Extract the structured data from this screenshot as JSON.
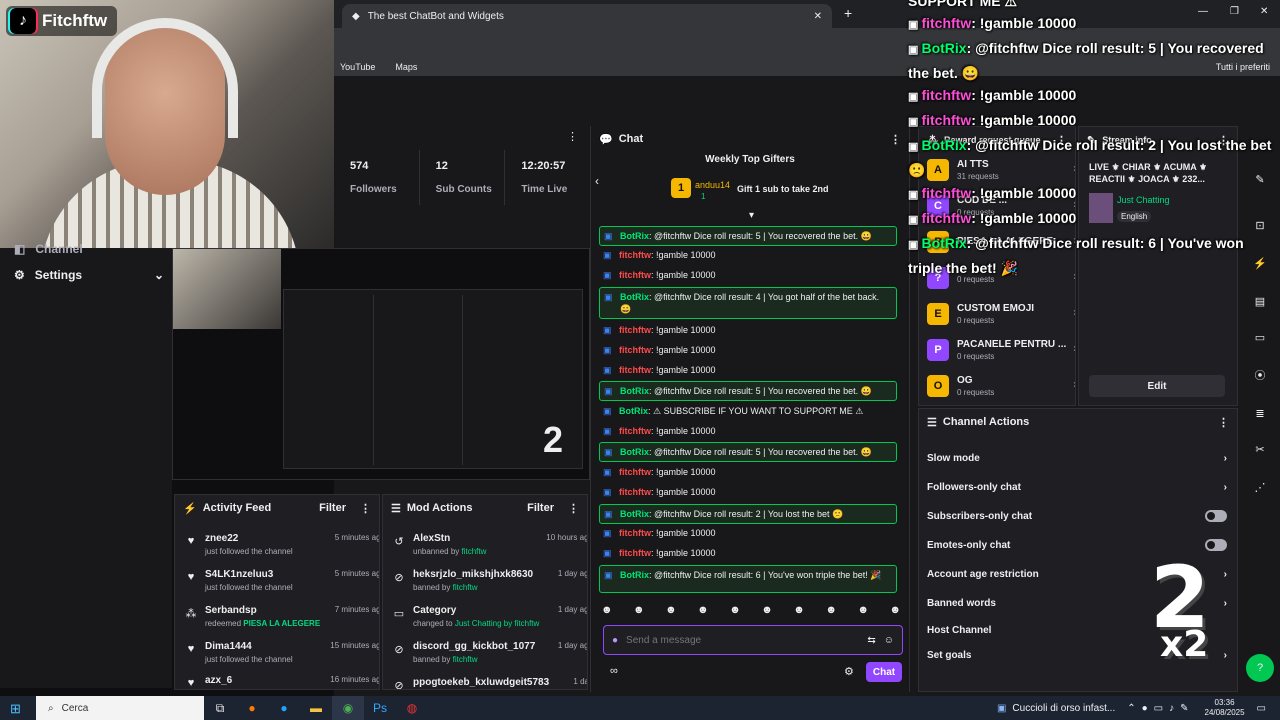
{
  "webcam": {
    "brand": "Fitchftw"
  },
  "browser": {
    "tab_title": "The best ChatBot and Widgets",
    "bookmarks": [
      "YouTube",
      "Maps"
    ],
    "bookmarks_right": "Tutti i preferiti"
  },
  "stats": [
    {
      "value": "574",
      "label": "Followers"
    },
    {
      "value": "12",
      "label": "Sub Counts"
    },
    {
      "value": "12:20:57",
      "label": "Time Live"
    }
  ],
  "left_nav": {
    "items": [
      {
        "label": "Channel"
      },
      {
        "label": "Settings"
      }
    ]
  },
  "activity_feed": {
    "title": "Activity Feed",
    "filter": "Filter",
    "rows": [
      {
        "name": "znee22",
        "text": "just followed the channel",
        "time": "5 minutes ago",
        "hl": ""
      },
      {
        "name": "S4LK1nzeluu3",
        "text": "just followed the channel",
        "time": "5 minutes ago",
        "hl": ""
      },
      {
        "name": "Serbandsp",
        "text": "redeemed",
        "time": "7 minutes ago",
        "hl": "PIESA LA ALEGERE"
      },
      {
        "name": "Dima1444",
        "text": "just followed the channel",
        "time": "15 minutes ago",
        "hl": ""
      },
      {
        "name": "azx_6",
        "text": "",
        "time": "16 minutes ago",
        "hl": ""
      }
    ]
  },
  "mod_actions": {
    "title": "Mod Actions",
    "filter": "Filter",
    "rows": [
      {
        "name": "AlexStn",
        "text": "unbanned by",
        "by": "fitchftw",
        "time": "10 hours ago"
      },
      {
        "name": "heksrjzlo_mikshjhxk8630",
        "text": "banned by",
        "by": "fitchftw",
        "time": "1 day ago"
      },
      {
        "name": "Category",
        "text": "changed to",
        "by": "Just Chatting by fitchftw",
        "time": "1 day ago"
      },
      {
        "name": "discord_gg_kickbot_1077",
        "text": "banned by",
        "by": "fitchftw",
        "time": "1 day ago"
      },
      {
        "name": "ppogtoekeb_kxluwdgeit5783",
        "text": "",
        "by": "",
        "time": "1 day"
      }
    ]
  },
  "chat": {
    "title": "Chat",
    "top_gifters_title": "Weekly Top Gifters",
    "gifter": {
      "rank": "1",
      "name": "anduu14",
      "count": "1"
    },
    "gift_cta": "Gift 1 sub to take 2nd",
    "messages": [
      {
        "bot": true,
        "user": "BotRix",
        "text": ": @fitchftw Dice roll result: 5 | You recovered the bet. 😀"
      },
      {
        "bot": false,
        "user": "fitchftw",
        "text": ": !gamble 10000"
      },
      {
        "bot": false,
        "user": "fitchftw",
        "text": ": !gamble 10000"
      },
      {
        "bot": true,
        "user": "BotRix",
        "text": ": @fitchftw Dice roll result: 4 | You got half of the bet back. 😀"
      },
      {
        "bot": false,
        "user": "fitchftw",
        "text": ": !gamble 10000"
      },
      {
        "bot": false,
        "user": "fitchftw",
        "text": ": !gamble 10000"
      },
      {
        "bot": false,
        "user": "fitchftw",
        "text": ": !gamble 10000"
      },
      {
        "bot": true,
        "user": "BotRix",
        "text": ": @fitchftw Dice roll result: 5 | You recovered the bet. 😀"
      },
      {
        "bot": false,
        "user": "BotRix",
        "text": ": ⚠ SUBSCRIBE IF YOU WANT TO SUPPORT ME ⚠"
      },
      {
        "bot": false,
        "user": "fitchftw",
        "text": ": !gamble 10000"
      },
      {
        "bot": true,
        "user": "BotRix",
        "text": ": @fitchftw Dice roll result: 5 | You recovered the bet. 😀"
      },
      {
        "bot": false,
        "user": "fitchftw",
        "text": ": !gamble 10000"
      },
      {
        "bot": false,
        "user": "fitchftw",
        "text": ": !gamble 10000"
      },
      {
        "bot": true,
        "user": "BotRix",
        "text": ": @fitchftw Dice roll result: 2 | You lost the bet 🙁"
      },
      {
        "bot": false,
        "user": "fitchftw",
        "text": ": !gamble 10000"
      },
      {
        "bot": false,
        "user": "fitchftw",
        "text": ": !gamble 10000"
      },
      {
        "bot": true,
        "user": "BotRix",
        "text": ": @fitchftw Dice roll result: 6 | You've won triple the bet! 🎉"
      }
    ],
    "input_placeholder": "Send a message",
    "send_label": "Chat"
  },
  "rewards": {
    "title": "Reward request queue",
    "items": [
      {
        "name": "AI TTS",
        "requests": "31 requests",
        "badge": "A"
      },
      {
        "name": "COD DE ...",
        "requests": "0 requests",
        "badge": "C"
      },
      {
        "name": "PIESA LA ALEGERE",
        "requests": "",
        "badge": "P"
      },
      {
        "name": "",
        "requests": "0 requests",
        "badge": "?"
      },
      {
        "name": "CUSTOM EMOJI",
        "requests": "0 requests",
        "badge": "E"
      },
      {
        "name": "PACANELE PENTRU ...",
        "requests": "0 requests",
        "badge": "P"
      },
      {
        "name": "OG",
        "requests": "0 requests",
        "badge": "O"
      }
    ]
  },
  "stream_info": {
    "title": "Stream info",
    "stream_title": "LIVE ⚜ CHIAR ⚜ ACUMA ⚜ REACTII ⚜ JOACA ⚜ 232...",
    "category": "Just Chatting",
    "language": "English",
    "edit_label": "Edit"
  },
  "channel_actions": {
    "title": "Channel Actions",
    "items": [
      {
        "label": "Slow mode",
        "control": "chevron"
      },
      {
        "label": "Followers-only chat",
        "control": "chevron"
      },
      {
        "label": "Subscribers-only chat",
        "control": "toggle"
      },
      {
        "label": "Emotes-only chat",
        "control": "toggle"
      },
      {
        "label": "Account age restriction",
        "control": "chevron"
      },
      {
        "label": "Banned words",
        "control": "chevron"
      },
      {
        "label": "Host Channel",
        "control": "none"
      },
      {
        "label": "Set goals",
        "control": "chevron"
      }
    ]
  },
  "overlay_chat": [
    {
      "user": "fitchftw",
      "bot": false,
      "text": ": !gamble 10000"
    },
    {
      "user": "BotRix",
      "bot": true,
      "text": ": @fitchftw Dice roll result: 5 | You recovered the bet. 😀"
    },
    {
      "user": "fitchftw",
      "bot": false,
      "text": ": !gamble 10000"
    },
    {
      "user": "fitchftw",
      "bot": false,
      "text": ": !gamble 10000"
    },
    {
      "user": "BotRix",
      "bot": true,
      "text": ": @fitchftw Dice roll result: 2 | You lost the bet 🙁"
    },
    {
      "user": "fitchftw",
      "bot": false,
      "text": ": !gamble 10000"
    },
    {
      "user": "fitchftw",
      "bot": false,
      "text": ": !gamble 10000"
    },
    {
      "user": "BotRix",
      "bot": true,
      "text": ": @fitchftw Dice roll result: 6 | You've won triple the bet! 🎉"
    }
  ],
  "overlay_top_text": "SUPPORT ME ⚠",
  "big_number": "2",
  "big_number_sub": "x2",
  "taskbar": {
    "search_placeholder": "Cerca",
    "news": "Cuccioli di orso infast...",
    "time": "03:36",
    "date": "24/08/2025"
  },
  "colors": {
    "accent": "#9147ff",
    "bot_green": "#00e676",
    "user_red": "#ff4b4b"
  }
}
